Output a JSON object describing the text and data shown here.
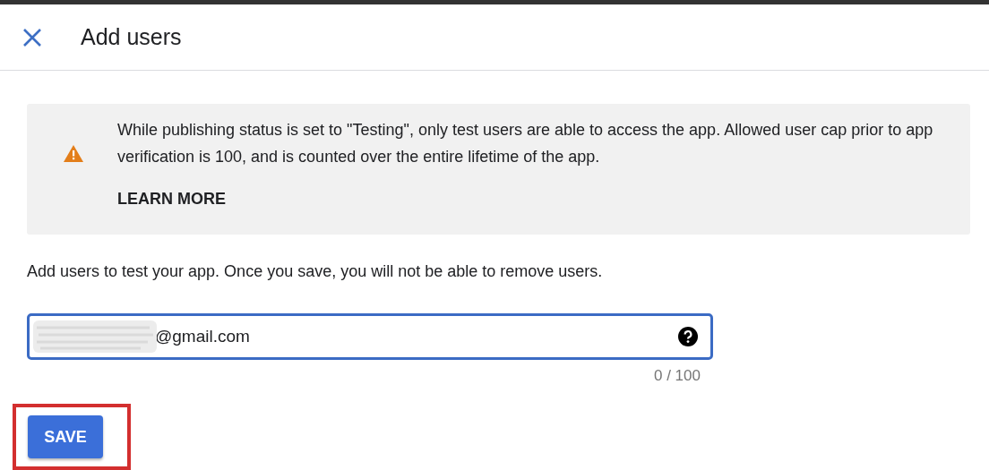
{
  "dialog": {
    "title": "Add users"
  },
  "notice": {
    "text": "While publishing status is set to \"Testing\", only test users are able to access the app. Allowed user cap prior to app verification is 100, and is counted over the entire lifetime of the app.",
    "link": "LEARN MORE"
  },
  "instruction": "Add users to test your app. Once you save, you will not be able to remove users.",
  "email_field": {
    "value": "@gmail.com",
    "redacted": true,
    "counter": "0 / 100"
  },
  "save_button": {
    "label": "SAVE",
    "highlighted": true
  }
}
